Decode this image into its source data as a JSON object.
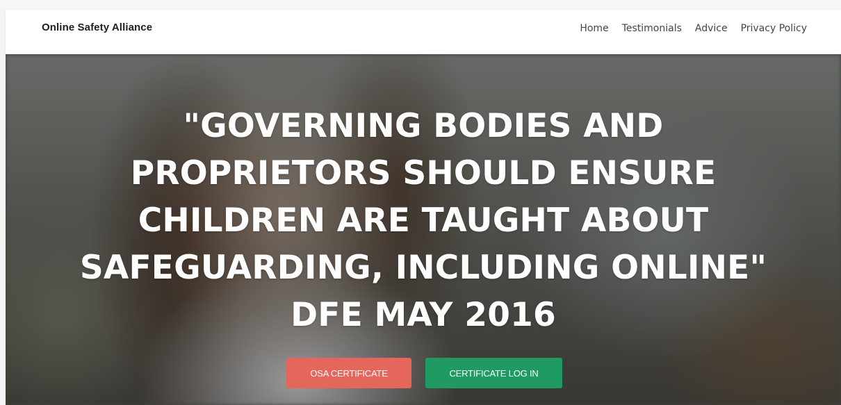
{
  "navbar": {
    "brand": "Online Safety Alliance",
    "links": [
      {
        "label": "Home"
      },
      {
        "label": "Testimonials"
      },
      {
        "label": "Advice"
      },
      {
        "label": "Privacy Policy"
      }
    ]
  },
  "hero": {
    "quote": "\"GOVERNING BODIES AND\nPROPRIETORS SHOULD ENSURE\nCHILDREN ARE TAUGHT ABOUT\nSAFEGUARDING, INCLUDING ONLINE\"\nDFE MAY 2016",
    "buttons": {
      "osa_certificate": "OSA CERTIFICATE",
      "certificate_login": "CERTIFICATE LOG IN"
    }
  },
  "colors": {
    "osa_button": "#e5665a",
    "login_button": "#209a63",
    "nav_text": "#444444",
    "brand_text": "#1f1f1f"
  }
}
